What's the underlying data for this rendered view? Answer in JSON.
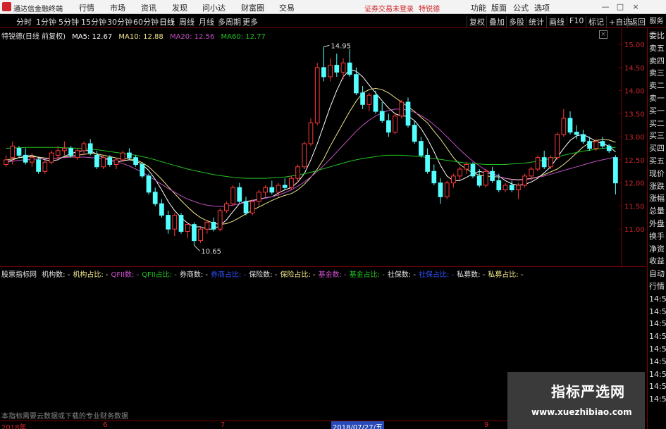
{
  "titlebar": {
    "app_name": "通达信金融终端",
    "menus": [
      "行情",
      "市场",
      "资讯",
      "发现",
      "问小达",
      "财富圈",
      "交易"
    ],
    "warning": "证券交易未登录",
    "stock_name": "特锐德",
    "right_menus": [
      "功能",
      "版面",
      "公式",
      "选项"
    ],
    "window_buttons": [
      "—",
      "□",
      "×"
    ]
  },
  "toolbar": {
    "periods": [
      "分时",
      "1分钟",
      "5分钟",
      "15分钟",
      "30分钟",
      "60分钟",
      "日线",
      "周线",
      "月线",
      "多周期",
      "更多"
    ],
    "active_period": "日线",
    "right_items": [
      "复权",
      "叠加",
      "多股",
      "统计",
      "画线",
      "F10",
      "标记",
      "+自选",
      "返回"
    ]
  },
  "sidebar_top": "服务",
  "legend": {
    "title": "特锐德(日线 前复权)",
    "ma5": "MA5: 12.67",
    "ma10": "MA10: 12.88",
    "ma20": "MA20: 12.56",
    "ma60": "MA60: 12.77"
  },
  "colors": {
    "up": "#ff3b3b",
    "down": "#54ffff",
    "ma5": "#ffffff",
    "ma10": "#f0e68c",
    "ma20": "#c050c0",
    "ma60": "#21c421",
    "grid": "#7a0000"
  },
  "chart_data": {
    "type": "candlestick",
    "yticks": [
      "15.00",
      "14.50",
      "14.00",
      "13.50",
      "13.00",
      "12.50",
      "12.00",
      "11.50",
      "11.00"
    ],
    "ylim": [
      10.5,
      15.2
    ],
    "high_label": "14.95",
    "low_label": "10.65",
    "candles": [
      [
        12.4,
        12.6,
        12.35,
        12.5
      ],
      [
        12.55,
        12.9,
        12.4,
        12.8
      ],
      [
        12.75,
        12.8,
        12.55,
        12.6
      ],
      [
        12.6,
        12.75,
        12.4,
        12.45
      ],
      [
        12.45,
        12.65,
        12.35,
        12.55
      ],
      [
        12.5,
        12.55,
        12.2,
        12.25
      ],
      [
        12.25,
        12.5,
        12.2,
        12.45
      ],
      [
        12.45,
        12.7,
        12.4,
        12.65
      ],
      [
        12.6,
        12.8,
        12.5,
        12.7
      ],
      [
        12.7,
        12.9,
        12.6,
        12.75
      ],
      [
        12.75,
        12.8,
        12.55,
        12.6
      ],
      [
        12.55,
        12.75,
        12.5,
        12.7
      ],
      [
        12.7,
        12.9,
        12.6,
        12.85
      ],
      [
        12.85,
        12.95,
        12.6,
        12.65
      ],
      [
        12.6,
        12.7,
        12.3,
        12.35
      ],
      [
        12.35,
        12.6,
        12.3,
        12.55
      ],
      [
        12.55,
        12.6,
        12.35,
        12.4
      ],
      [
        12.4,
        12.55,
        12.3,
        12.5
      ],
      [
        12.5,
        12.7,
        12.45,
        12.65
      ],
      [
        12.65,
        12.75,
        12.5,
        12.55
      ],
      [
        12.55,
        12.6,
        12.35,
        12.4
      ],
      [
        12.4,
        12.45,
        12.1,
        12.15
      ],
      [
        12.15,
        12.2,
        11.75,
        11.8
      ],
      [
        11.8,
        11.9,
        11.5,
        11.55
      ],
      [
        11.55,
        11.65,
        11.25,
        11.3
      ],
      [
        11.3,
        11.4,
        10.9,
        11.0
      ],
      [
        11.0,
        11.35,
        10.85,
        11.3
      ],
      [
        11.3,
        11.35,
        10.9,
        10.95
      ],
      [
        10.95,
        11.15,
        10.8,
        11.1
      ],
      [
        11.1,
        11.15,
        10.65,
        10.75
      ],
      [
        10.75,
        11.05,
        10.7,
        11.0
      ],
      [
        11.0,
        11.2,
        10.9,
        11.15
      ],
      [
        11.15,
        11.25,
        10.95,
        11.0
      ],
      [
        11.0,
        11.45,
        10.95,
        11.4
      ],
      [
        11.4,
        11.6,
        11.35,
        11.55
      ],
      [
        11.55,
        11.95,
        11.5,
        11.9
      ],
      [
        11.9,
        12.0,
        11.55,
        11.6
      ],
      [
        11.6,
        11.7,
        11.3,
        11.35
      ],
      [
        11.35,
        11.65,
        11.3,
        11.6
      ],
      [
        11.6,
        11.85,
        11.5,
        11.8
      ],
      [
        11.8,
        11.95,
        11.7,
        11.9
      ],
      [
        11.9,
        12.05,
        11.75,
        11.8
      ],
      [
        11.8,
        12.0,
        11.7,
        11.95
      ],
      [
        11.95,
        12.1,
        11.85,
        11.9
      ],
      [
        11.9,
        12.15,
        11.85,
        12.1
      ],
      [
        12.1,
        12.4,
        12.0,
        12.35
      ],
      [
        12.35,
        12.9,
        12.3,
        12.85
      ],
      [
        12.85,
        13.4,
        12.8,
        13.3
      ],
      [
        13.3,
        14.6,
        13.25,
        14.5
      ],
      [
        14.5,
        14.95,
        14.2,
        14.3
      ],
      [
        14.3,
        14.7,
        14.2,
        14.55
      ],
      [
        14.55,
        14.8,
        14.3,
        14.4
      ],
      [
        14.4,
        14.7,
        14.25,
        14.6
      ],
      [
        14.6,
        14.9,
        14.3,
        14.35
      ],
      [
        14.35,
        14.5,
        13.9,
        13.95
      ],
      [
        13.95,
        14.1,
        13.6,
        13.7
      ],
      [
        13.7,
        13.95,
        13.55,
        13.9
      ],
      [
        13.9,
        14.0,
        13.5,
        13.55
      ],
      [
        13.55,
        13.75,
        13.3,
        13.35
      ],
      [
        13.35,
        13.5,
        13.0,
        13.1
      ],
      [
        13.1,
        13.5,
        13.05,
        13.45
      ],
      [
        13.45,
        13.8,
        13.4,
        13.75
      ],
      [
        13.75,
        13.85,
        13.2,
        13.25
      ],
      [
        13.25,
        13.35,
        12.85,
        12.9
      ],
      [
        12.9,
        13.0,
        12.55,
        12.6
      ],
      [
        12.6,
        12.75,
        12.2,
        12.25
      ],
      [
        12.25,
        12.4,
        11.95,
        12.0
      ],
      [
        12.0,
        12.1,
        11.55,
        11.7
      ],
      [
        11.7,
        12.05,
        11.65,
        12.0
      ],
      [
        12.0,
        12.2,
        11.9,
        12.15
      ],
      [
        12.15,
        12.35,
        12.05,
        12.3
      ],
      [
        12.3,
        12.45,
        12.2,
        12.4
      ],
      [
        12.4,
        12.45,
        12.1,
        12.15
      ],
      [
        12.15,
        12.3,
        11.9,
        11.95
      ],
      [
        11.95,
        12.3,
        11.9,
        12.25
      ],
      [
        12.25,
        12.35,
        12.0,
        12.05
      ],
      [
        12.05,
        12.2,
        11.8,
        11.85
      ],
      [
        11.85,
        12.0,
        11.8,
        11.95
      ],
      [
        11.95,
        12.05,
        11.8,
        11.85
      ],
      [
        11.85,
        12.0,
        11.65,
        11.95
      ],
      [
        11.95,
        12.2,
        11.9,
        12.15
      ],
      [
        12.15,
        12.35,
        12.05,
        12.3
      ],
      [
        12.3,
        12.6,
        12.25,
        12.55
      ],
      [
        12.55,
        12.7,
        12.3,
        12.35
      ],
      [
        12.35,
        12.6,
        12.3,
        12.55
      ],
      [
        12.55,
        13.1,
        12.5,
        13.05
      ],
      [
        13.05,
        13.6,
        13.0,
        13.4
      ],
      [
        13.4,
        13.55,
        13.05,
        13.1
      ],
      [
        13.1,
        13.25,
        12.95,
        13.05
      ],
      [
        13.05,
        13.15,
        12.85,
        12.9
      ],
      [
        12.9,
        13.0,
        12.7,
        12.75
      ],
      [
        12.75,
        12.95,
        12.7,
        12.9
      ],
      [
        12.9,
        13.0,
        12.75,
        12.8
      ],
      [
        12.8,
        12.85,
        12.65,
        12.7
      ],
      [
        12.55,
        12.6,
        11.75,
        12.0
      ]
    ],
    "ma_series": [
      {
        "name": "MA5",
        "values": [
          12.45,
          12.5,
          12.55,
          12.58,
          12.6,
          12.55,
          12.5,
          12.48,
          12.5,
          12.58,
          12.63,
          12.68,
          12.7,
          12.7,
          12.62,
          12.55,
          12.5,
          12.45,
          12.48,
          12.5,
          12.48,
          12.4,
          12.27,
          12.08,
          11.85,
          11.6,
          11.4,
          11.25,
          11.13,
          11.05,
          11.05,
          11.0,
          11.0,
          11.08,
          11.2,
          11.38,
          11.55,
          11.6,
          11.62,
          11.65,
          11.68,
          11.7,
          11.78,
          11.85,
          11.9,
          12.02,
          12.2,
          12.5,
          12.85,
          13.25,
          13.65,
          14.0,
          14.3,
          14.45,
          14.42,
          14.3,
          14.12,
          13.95,
          13.78,
          13.62,
          13.5,
          13.45,
          13.45,
          13.35,
          13.18,
          12.95,
          12.68,
          12.38,
          12.15,
          12.05,
          12.05,
          12.12,
          12.2,
          12.25,
          12.22,
          12.2,
          12.15,
          12.05,
          11.98,
          11.95,
          11.97,
          12.02,
          12.1,
          12.22,
          12.35,
          12.55,
          12.75,
          12.92,
          13.02,
          13.05,
          12.98,
          12.9,
          12.85,
          12.8,
          12.67
        ]
      },
      {
        "name": "MA10",
        "values": [
          12.5,
          12.52,
          12.55,
          12.56,
          12.57,
          12.56,
          12.54,
          12.53,
          12.54,
          12.56,
          12.58,
          12.6,
          12.62,
          12.64,
          12.63,
          12.6,
          12.57,
          12.54,
          12.53,
          12.52,
          12.5,
          12.44,
          12.35,
          12.22,
          12.08,
          11.92,
          11.77,
          11.62,
          11.48,
          11.35,
          11.25,
          11.18,
          11.13,
          11.1,
          11.12,
          11.17,
          11.25,
          11.33,
          11.41,
          11.48,
          11.55,
          11.62,
          11.68,
          11.73,
          11.77,
          11.85,
          11.97,
          12.12,
          12.3,
          12.52,
          12.8,
          13.05,
          13.3,
          13.55,
          13.77,
          13.95,
          14.02,
          14.05,
          14.02,
          13.95,
          13.85,
          13.75,
          13.65,
          13.55,
          13.42,
          13.3,
          13.12,
          12.95,
          12.75,
          12.55,
          12.4,
          12.3,
          12.22,
          12.17,
          12.15,
          12.14,
          12.13,
          12.1,
          12.08,
          12.07,
          12.08,
          12.1,
          12.13,
          12.18,
          12.24,
          12.3,
          12.4,
          12.52,
          12.65,
          12.78,
          12.87,
          12.92,
          12.94,
          12.93,
          12.88
        ]
      },
      {
        "name": "MA20",
        "values": [
          12.45,
          12.47,
          12.49,
          12.5,
          12.51,
          12.52,
          12.52,
          12.53,
          12.54,
          12.55,
          12.56,
          12.56,
          12.56,
          12.55,
          12.54,
          12.52,
          12.5,
          12.46,
          12.42,
          12.37,
          12.3,
          12.23,
          12.15,
          12.06,
          11.97,
          11.88,
          11.8,
          11.72,
          11.65,
          11.6,
          11.55,
          11.52,
          11.5,
          11.49,
          11.5,
          11.52,
          11.55,
          11.58,
          11.61,
          11.64,
          11.67,
          11.7,
          11.74,
          11.79,
          11.85,
          11.93,
          12.02,
          12.13,
          12.25,
          12.38,
          12.52,
          12.67,
          12.82,
          12.97,
          13.12,
          13.25,
          13.36,
          13.45,
          13.52,
          13.57,
          13.6,
          13.6,
          13.58,
          13.53,
          13.46,
          13.37,
          13.26,
          13.14,
          13.0,
          12.86,
          12.72,
          12.59,
          12.47,
          12.37,
          12.28,
          12.2,
          12.14,
          12.1,
          12.07,
          12.06,
          12.07,
          12.09,
          12.12,
          12.15,
          12.19,
          12.23,
          12.27,
          12.31,
          12.35,
          12.39,
          12.43,
          12.47,
          12.5,
          12.53,
          12.56
        ]
      },
      {
        "name": "MA60",
        "values": [
          12.75,
          12.76,
          12.76,
          12.77,
          12.77,
          12.77,
          12.77,
          12.77,
          12.77,
          12.76,
          12.76,
          12.75,
          12.74,
          12.73,
          12.72,
          12.7,
          12.68,
          12.66,
          12.64,
          12.62,
          12.6,
          12.57,
          12.54,
          12.5,
          12.46,
          12.42,
          12.38,
          12.34,
          12.3,
          12.27,
          12.24,
          12.21,
          12.18,
          12.16,
          12.14,
          12.12,
          12.11,
          12.1,
          12.1,
          12.1,
          12.1,
          12.11,
          12.12,
          12.13,
          12.15,
          12.17,
          12.2,
          12.23,
          12.27,
          12.31,
          12.35,
          12.39,
          12.43,
          12.47,
          12.5,
          12.53,
          12.55,
          12.57,
          12.59,
          12.6,
          12.6,
          12.6,
          12.59,
          12.58,
          12.57,
          12.55,
          12.53,
          12.51,
          12.49,
          12.47,
          12.45,
          12.43,
          12.42,
          12.41,
          12.4,
          12.4,
          12.4,
          12.4,
          12.41,
          12.42,
          12.43,
          12.45,
          12.47,
          12.5,
          12.53,
          12.56,
          12.6,
          12.63,
          12.66,
          12.69,
          12.71,
          12.73,
          12.75,
          12.76,
          12.77
        ]
      }
    ]
  },
  "sidebar": {
    "items": [
      "委比",
      "卖五",
      "卖四",
      "卖三",
      "卖二",
      "卖一",
      "买一",
      "买二",
      "买三",
      "买四",
      "买五",
      "现价",
      "涨跌",
      "涨幅",
      "总量",
      "外盘",
      "换手",
      "净资",
      "收益",
      "自动",
      "行情",
      "14:5",
      "14:5",
      "14:5",
      "14:5",
      "14:5",
      "14:5",
      "14:5",
      "14:5",
      "14:5"
    ]
  },
  "indicator": {
    "name": "股票指标网",
    "items": [
      {
        "label": "机构数:",
        "value": "-",
        "color": "#e0e0e0"
      },
      {
        "label": "机构占比:",
        "value": "-",
        "color": "#f0e68c"
      },
      {
        "label": "QFII数:",
        "value": "-",
        "color": "#d050d0"
      },
      {
        "label": "QFII占比:",
        "value": "-",
        "color": "#21c421"
      },
      {
        "label": "券商数:",
        "value": "-",
        "color": "#e0e0e0"
      },
      {
        "label": "券商占比:",
        "value": "-",
        "color": "#3050ff"
      },
      {
        "label": "保险数:",
        "value": "-",
        "color": "#e0e0e0"
      },
      {
        "label": "保险占比:",
        "value": "-",
        "color": "#f0e68c"
      },
      {
        "label": "基金数:",
        "value": "-",
        "color": "#d050d0"
      },
      {
        "label": "基金占比:",
        "value": "-",
        "color": "#21c421"
      },
      {
        "label": "社保数:",
        "value": "-",
        "color": "#e0e0e0"
      },
      {
        "label": "社保占比:",
        "value": "-",
        "color": "#3050ff"
      },
      {
        "label": "私募数:",
        "value": "-",
        "color": "#e0e0e0"
      },
      {
        "label": "私募占比:",
        "value": "-",
        "color": "#f0e68c"
      }
    ]
  },
  "bottom_note": "本指标需要云数据或下载的专业财务数据",
  "date_axis": [
    "2018年",
    "6",
    "7",
    "2018/07/27/五",
    "9"
  ],
  "watermark": {
    "line1": "指标严选网",
    "line2": "www.xuezhibiao.com"
  }
}
